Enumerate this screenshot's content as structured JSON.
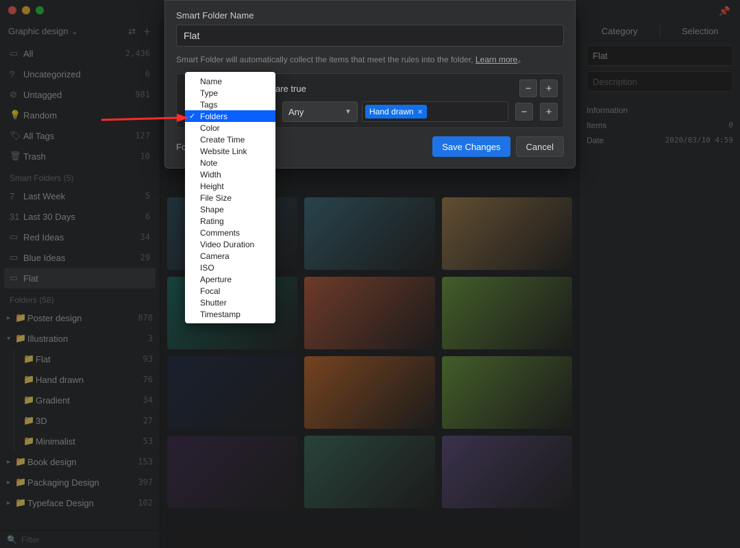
{
  "titlebar": {
    "pin_icon": "📌"
  },
  "sidebar": {
    "library_label": "Graphic design",
    "swap_icon": "⇄",
    "add_icon": "＋",
    "items": [
      {
        "icon": "▭",
        "label": "All",
        "count": "2,436"
      },
      {
        "icon": "?",
        "label": "Uncategorized",
        "count": "6"
      },
      {
        "icon": "⊘",
        "label": "Untagged",
        "count": "981"
      },
      {
        "icon": "💡",
        "label": "Random",
        "count": ""
      },
      {
        "icon": "🏷",
        "label": "All Tags",
        "count": "127"
      },
      {
        "icon": "🗑",
        "label": "Trash",
        "count": "10"
      }
    ],
    "smart_header": "Smart Folders (5)",
    "smart": [
      {
        "icon": "7",
        "label": "Last Week",
        "count": "5"
      },
      {
        "icon": "31",
        "label": "Last 30 Days",
        "count": "6"
      },
      {
        "icon": "▭",
        "label": "Red Ideas",
        "count": "34"
      },
      {
        "icon": "▭",
        "label": "Blue Ideas",
        "count": "29"
      },
      {
        "icon": "▭",
        "label": "Flat",
        "count": "",
        "active": true
      }
    ],
    "folders_header": "Folders (58)",
    "folders": [
      {
        "disc": "▸",
        "color": "fc-orange",
        "label": "Poster design",
        "count": "878"
      },
      {
        "disc": "▾",
        "color": "fc-orange",
        "label": "Illustration",
        "count": "3",
        "children": [
          {
            "color": "fc-orange",
            "label": "Flat",
            "count": "93",
            "lock": true
          },
          {
            "color": "fc-orange",
            "label": "Hand drawn",
            "count": "76"
          },
          {
            "color": "fc-orange",
            "label": "Gradient",
            "count": "34"
          },
          {
            "color": "fc-orange",
            "label": "3D",
            "count": "27"
          },
          {
            "color": "fc-orange",
            "label": "Minimalist",
            "count": "53"
          }
        ]
      },
      {
        "disc": "▸",
        "color": "fc-green",
        "label": "Book design",
        "count": "153"
      },
      {
        "disc": "▸",
        "color": "fc-teal",
        "label": "Packaging Design",
        "count": "397"
      },
      {
        "disc": "▸",
        "color": "fc-blue",
        "label": "Typeface Design",
        "count": "102"
      }
    ],
    "filter_icon": "🔍",
    "filter_placeholder": "Filter"
  },
  "modal": {
    "title": "Smart Folder Name",
    "name_value": "Flat",
    "desc_a": "Smart Folder will automatically collect the items that meet the rules into the folder, ",
    "desc_link": "Learn more",
    "desc_b": "。",
    "rule_text_tail": " are true",
    "condition_label": "Any",
    "tag_value": "Hand drawn",
    "foot_left": "Fo                                        ons.",
    "save": "Save Changes",
    "cancel": "Cancel"
  },
  "dropdown": {
    "items": [
      "Name",
      "Type",
      "Tags",
      "Folders",
      "Color",
      "Create Time",
      "Website Link",
      "Note",
      "Width",
      "Height",
      "File Size",
      "Shape",
      "Rating",
      "Comments",
      "Video Duration",
      "Camera",
      "ISO",
      "Aperture",
      "Focal",
      "Shutter",
      "Timestamp"
    ],
    "selected": "Folders"
  },
  "right": {
    "tab_a": "Category",
    "tab_b": "Selection",
    "name_value": "Flat",
    "desc_placeholder": "Description",
    "info_header": "Information",
    "rows": [
      {
        "k": "Items",
        "v": "0"
      },
      {
        "k": "Date",
        "v": "2020/03/10 4:59"
      }
    ]
  },
  "thumbs": [
    [
      "#2b4a5c",
      "#3a6a7a",
      "#a07e4a"
    ],
    [
      "#1a6a5e",
      "#b85a3a",
      "#6a9a3a"
    ],
    [
      "#1e2a44",
      "#c66a2a",
      "#6a9a3a"
    ],
    [
      "#3a2a4a",
      "#3a6a5a",
      "#5a4a7a"
    ]
  ]
}
